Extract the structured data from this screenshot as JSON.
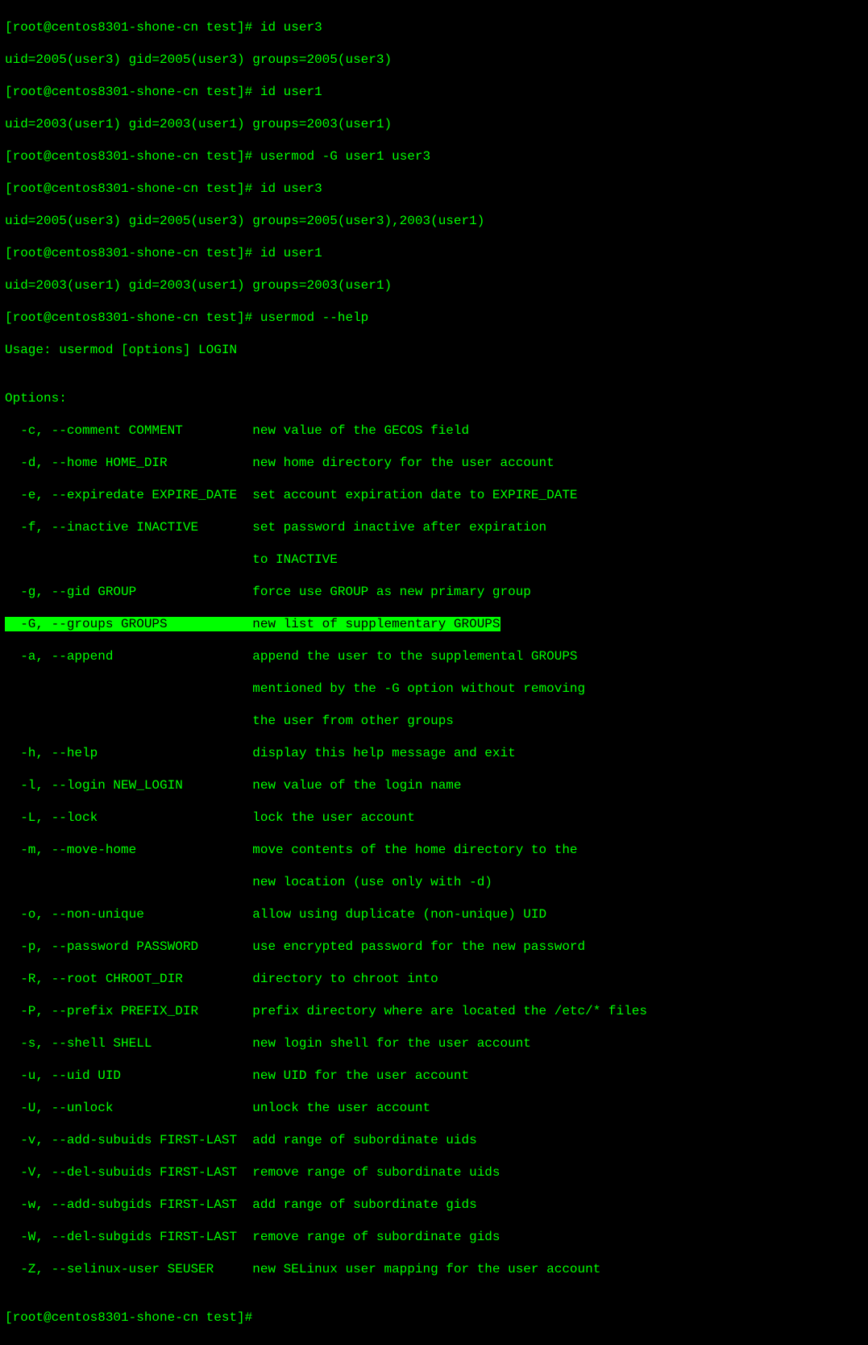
{
  "prompt": "[root@centos8301-shone-cn test]# ",
  "cmd1": "id user3",
  "out1": "uid=2005(user3) gid=2005(user3) groups=2005(user3)",
  "cmd2": "id user1",
  "out2": "uid=2003(user1) gid=2003(user1) groups=2003(user1)",
  "cmd3": "usermod -G user1 user3",
  "cmd4": "id user3",
  "out4": "uid=2005(user3) gid=2005(user3) groups=2005(user3),2003(user1)",
  "cmd5": "id user1",
  "out5": "uid=2003(user1) gid=2003(user1) groups=2003(user1)",
  "cmd6": "usermod --help",
  "usage": "Usage: usermod [options] LOGIN",
  "blank": "",
  "opts_hdr": "Options:",
  "opt_c": "  -c, --comment COMMENT         new value of the GECOS field",
  "opt_d": "  -d, --home HOME_DIR           new home directory for the user account",
  "opt_e": "  -e, --expiredate EXPIRE_DATE  set account expiration date to EXPIRE_DATE",
  "opt_f": "  -f, --inactive INACTIVE       set password inactive after expiration",
  "opt_f2": "                                to INACTIVE",
  "opt_g": "  -g, --gid GROUP               force use GROUP as new primary group",
  "opt_G_a": "  -G, --groups GROUPS           ",
  "opt_G_b": "new list of supplementary GROUPS",
  "opt_a": "  -a, --append                  append the user to the supplemental GROUPS",
  "opt_a2": "                                mentioned by the -G option without removing",
  "opt_a3": "                                the user from other groups",
  "opt_h": "  -h, --help                    display this help message and exit",
  "opt_l": "  -l, --login NEW_LOGIN         new value of the login name",
  "opt_L": "  -L, --lock                    lock the user account",
  "opt_m": "  -m, --move-home               move contents of the home directory to the",
  "opt_m2": "                                new location (use only with -d)",
  "opt_o": "  -o, --non-unique              allow using duplicate (non-unique) UID",
  "opt_p": "  -p, --password PASSWORD       use encrypted password for the new password",
  "opt_R": "  -R, --root CHROOT_DIR         directory to chroot into",
  "opt_P": "  -P, --prefix PREFIX_DIR       prefix directory where are located the /etc/* files",
  "opt_s": "  -s, --shell SHELL             new login shell for the user account",
  "opt_u": "  -u, --uid UID                 new UID for the user account",
  "opt_U": "  -U, --unlock                  unlock the user account",
  "opt_v": "  -v, --add-subuids FIRST-LAST  add range of subordinate uids",
  "opt_V": "  -V, --del-subuids FIRST-LAST  remove range of subordinate uids",
  "opt_w": "  -w, --add-subgids FIRST-LAST  add range of subordinate gids",
  "opt_W": "  -W, --del-subgids FIRST-LAST  remove range of subordinate gids",
  "opt_Z": "  -Z, --selinux-user SEUSER     new SELinux user mapping for the user account"
}
